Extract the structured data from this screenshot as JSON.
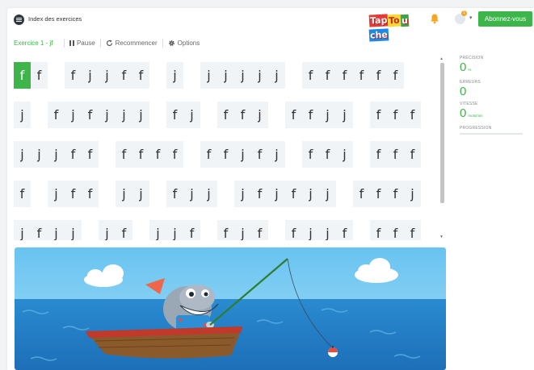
{
  "header": {
    "index_label": "Index des exercices",
    "logo_letters": [
      "Tap",
      "To",
      "u",
      "che"
    ],
    "notification_count": "1",
    "subscribe_label": "Abonnez-vous"
  },
  "toolbar": {
    "exercise_title": "Exercice 1 - jf",
    "pause_label": "Pause",
    "restart_label": "Recommencer",
    "options_label": "Options"
  },
  "text_rows": [
    [
      "ff",
      "fjjff",
      "j",
      "jjjjj",
      "ffffff"
    ],
    [
      "j",
      "fjfjjj",
      "fj",
      "ffj",
      "ffjj",
      "fff"
    ],
    [
      "jjjff",
      "ffff",
      "ffjfj",
      "ffj",
      "fff"
    ],
    [
      "f",
      "jff",
      "jj",
      "fjj",
      "jfjfjj",
      "fffj"
    ],
    [
      "jfjj",
      "jf",
      "jjf",
      "fjf",
      "fjjf",
      "fff"
    ]
  ],
  "stats": {
    "precision_label": "PRÉCISION",
    "precision_value": "0",
    "precision_unit": "%",
    "errors_label": "ERREURS",
    "errors_value": "0",
    "speed_label": "VITESSE",
    "speed_value": "0",
    "speed_unit": "mots/min",
    "progress_label": "PROGRESSION",
    "progress_fraction": 0
  },
  "colors": {
    "accent": "#3db54a",
    "sky": "#7ecff4",
    "sea": "#2f8fd0",
    "boat": "#8b5a2b"
  }
}
